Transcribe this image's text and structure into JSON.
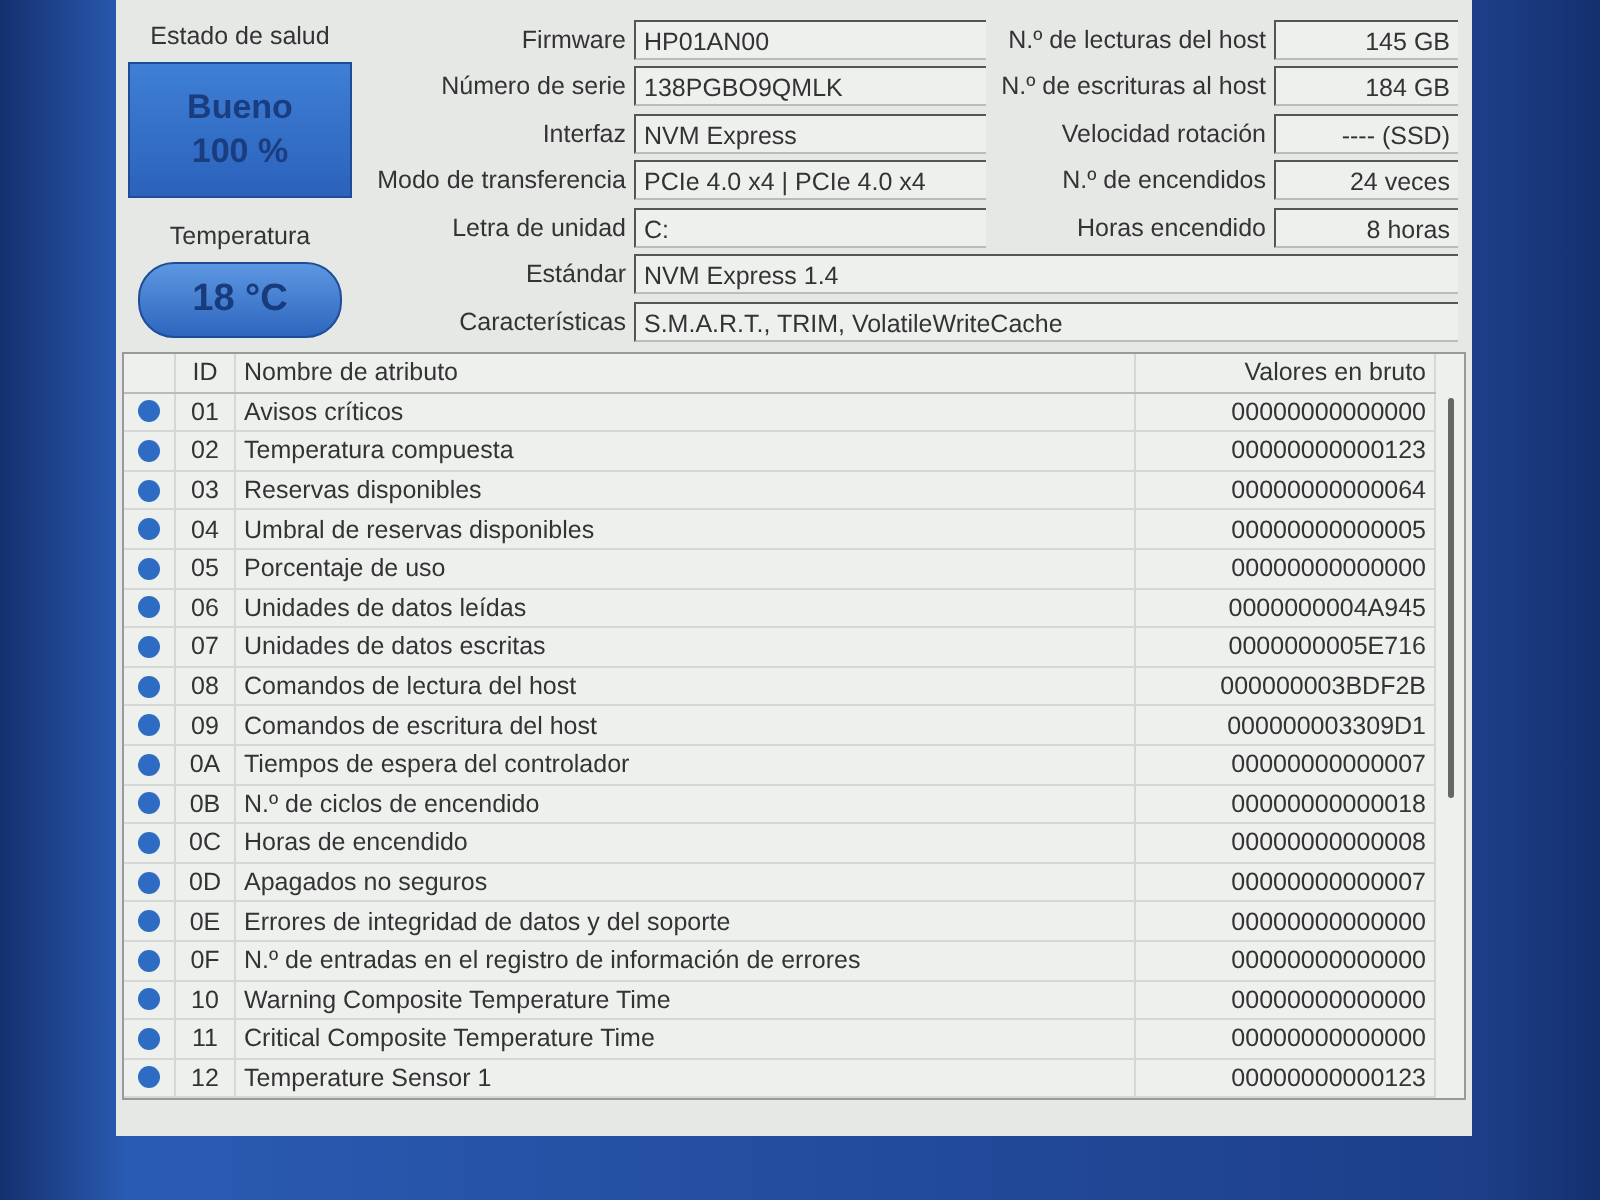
{
  "health": {
    "label": "Estado de salud",
    "status": "Bueno",
    "percent": "100 %"
  },
  "temperature": {
    "label": "Temperatura",
    "value": "18 °C"
  },
  "info_left": [
    {
      "label": "Firmware",
      "value": "HP01AN00"
    },
    {
      "label": "Número de serie",
      "value": "138PGBO9QMLK"
    },
    {
      "label": "Interfaz",
      "value": "NVM Express"
    },
    {
      "label": "Modo de transferencia",
      "value": "PCIe 4.0 x4 | PCIe 4.0 x4"
    },
    {
      "label": "Letra de unidad",
      "value": "C:"
    }
  ],
  "info_right": [
    {
      "label": "N.º de lecturas del host",
      "value": "145 GB"
    },
    {
      "label": "N.º de escrituras al host",
      "value": "184 GB"
    },
    {
      "label": "Velocidad rotación",
      "value": "---- (SSD)"
    },
    {
      "label": "N.º de encendidos",
      "value": "24 veces"
    },
    {
      "label": "Horas encendido",
      "value": "8 horas"
    }
  ],
  "info_wide": [
    {
      "label": "Estándar",
      "value": "NVM Express 1.4"
    },
    {
      "label": "Características",
      "value": "S.M.A.R.T., TRIM, VolatileWriteCache"
    }
  ],
  "table": {
    "columns": [
      "ID",
      "Nombre de atributo",
      "Valores en bruto"
    ],
    "rows": [
      {
        "id": "01",
        "name": "Avisos críticos",
        "raw": "00000000000000",
        "color": "#2e6cc4"
      },
      {
        "id": "02",
        "name": "Temperatura compuesta",
        "raw": "00000000000123",
        "color": "#2e6cc4"
      },
      {
        "id": "03",
        "name": "Reservas disponibles",
        "raw": "00000000000064",
        "color": "#2e6cc4"
      },
      {
        "id": "04",
        "name": "Umbral de reservas disponibles",
        "raw": "00000000000005",
        "color": "#2e6cc4"
      },
      {
        "id": "05",
        "name": "Porcentaje de uso",
        "raw": "00000000000000",
        "color": "#2e6cc4"
      },
      {
        "id": "06",
        "name": "Unidades de datos leídas",
        "raw": "0000000004A945",
        "color": "#2e6cc4"
      },
      {
        "id": "07",
        "name": "Unidades de datos escritas",
        "raw": "0000000005E716",
        "color": "#2e6cc4"
      },
      {
        "id": "08",
        "name": "Comandos de lectura del host",
        "raw": "000000003BDF2B",
        "color": "#2e6cc4"
      },
      {
        "id": "09",
        "name": "Comandos de escritura del host",
        "raw": "000000003309D1",
        "color": "#2e6cc4"
      },
      {
        "id": "0A",
        "name": "Tiempos de espera del controlador",
        "raw": "00000000000007",
        "color": "#2e6cc4"
      },
      {
        "id": "0B",
        "name": "N.º de ciclos de encendido",
        "raw": "00000000000018",
        "color": "#2e6cc4"
      },
      {
        "id": "0C",
        "name": "Horas de encendido",
        "raw": "00000000000008",
        "color": "#2e6cc4"
      },
      {
        "id": "0D",
        "name": "Apagados no seguros",
        "raw": "00000000000007",
        "color": "#2e6cc4"
      },
      {
        "id": "0E",
        "name": "Errores de integridad de datos y del soporte",
        "raw": "00000000000000",
        "color": "#2e6cc4"
      },
      {
        "id": "0F",
        "name": "N.º de entradas en el registro de información de errores",
        "raw": "00000000000000",
        "color": "#2e6cc4"
      },
      {
        "id": "10",
        "name": "Warning Composite Temperature Time",
        "raw": "00000000000000",
        "color": "#2e6cc4"
      },
      {
        "id": "11",
        "name": "Critical Composite Temperature Time",
        "raw": "00000000000000",
        "color": "#2e6cc4"
      },
      {
        "id": "12",
        "name": "Temperature Sensor 1",
        "raw": "00000000000123",
        "color": "#2e6cc4"
      }
    ]
  }
}
